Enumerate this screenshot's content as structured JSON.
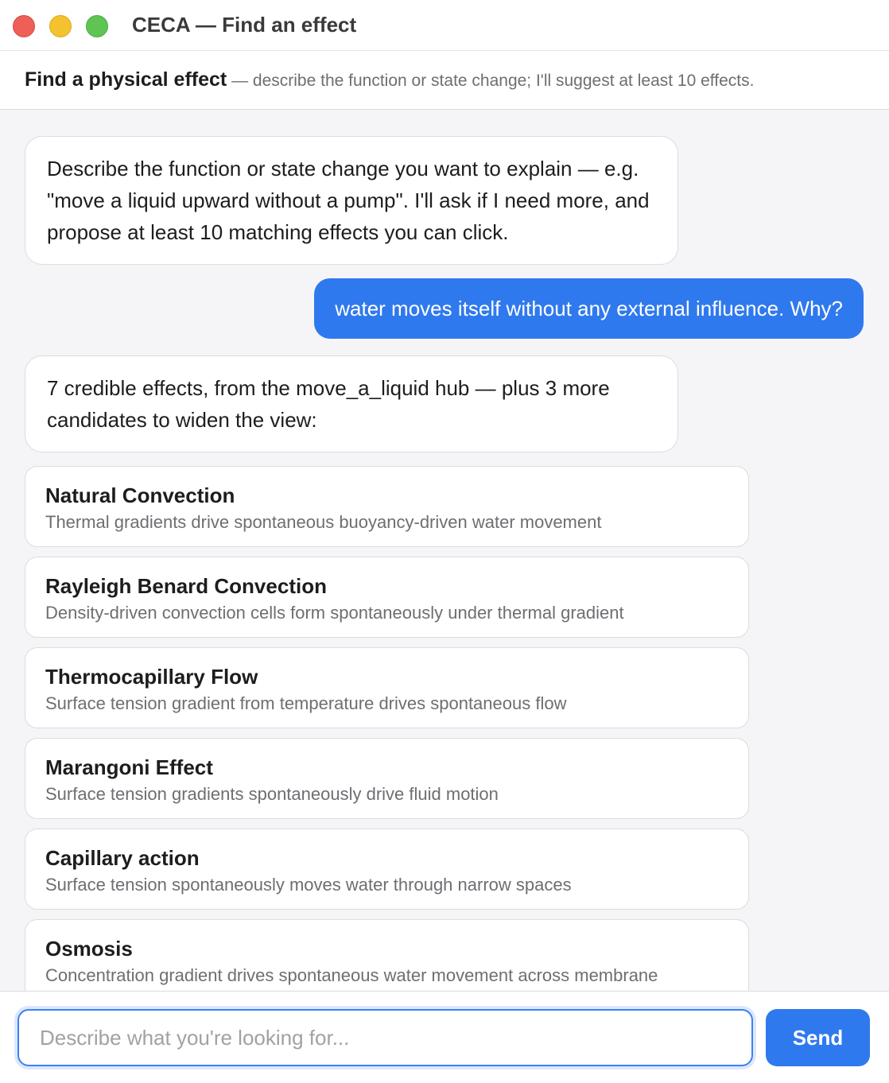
{
  "window": {
    "title": "CECA — Find an effect"
  },
  "header": {
    "title": "Find a physical effect",
    "subtitle": " — describe the function or state change; I'll suggest at least 10 effects."
  },
  "messages": [
    {
      "role": "assistant",
      "text": "Describe the function or state change you want to explain — e.g. \"move a liquid upward without a pump\". I'll ask if I need more, and propose at least 10 matching effects you can click."
    },
    {
      "role": "user",
      "text": "water moves itself without any external influence. Why?"
    },
    {
      "role": "assistant",
      "text": "7 credible effects, from the move_a_liquid hub — plus 3 more candidates to widen the view:"
    }
  ],
  "effects": [
    {
      "name": "Natural Convection",
      "description": "Thermal gradients drive spontaneous buoyancy-driven water movement"
    },
    {
      "name": "Rayleigh Benard Convection",
      "description": "Density-driven convection cells form spontaneously under thermal gradient"
    },
    {
      "name": "Thermocapillary Flow",
      "description": "Surface tension gradient from temperature drives spontaneous flow"
    },
    {
      "name": "Marangoni Effect",
      "description": "Surface tension gradients spontaneously drive fluid motion"
    },
    {
      "name": "Capillary action",
      "description": "Surface tension spontaneously moves water through narrow spaces"
    },
    {
      "name": "Osmosis",
      "description": "Concentration gradient drives spontaneous water movement across membrane"
    }
  ],
  "input": {
    "placeholder": "Describe what you're looking for...",
    "value": ""
  },
  "send_button": {
    "label": "Send"
  },
  "colors": {
    "accent": "#2f79ee",
    "close": "#ee5f57",
    "minimize": "#f4c22f",
    "zoom": "#5fc454"
  }
}
